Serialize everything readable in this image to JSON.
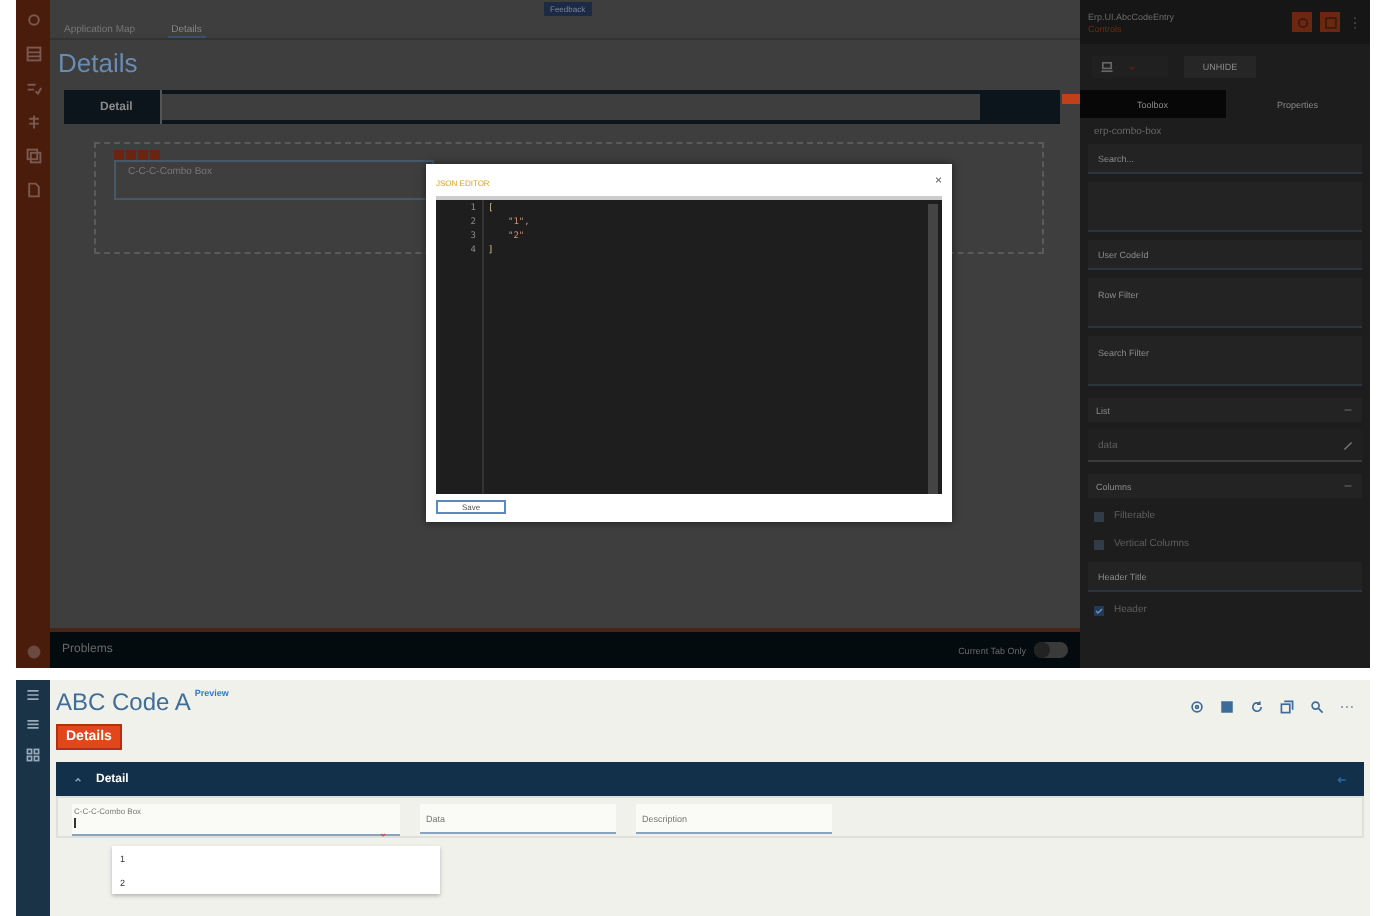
{
  "designer": {
    "feedback": "Feedback",
    "tabs": [
      {
        "label": "Application Map",
        "selected": false
      },
      {
        "label": "Details",
        "selected": true
      }
    ],
    "title": "Details",
    "panel_title": "Detail",
    "component_label": "C-C-C-Combo Box",
    "problems": "Problems",
    "toggle": {
      "label": "Current Tab Only",
      "on": false
    }
  },
  "side": {
    "title": "Erp.UI.AbcCodeEntry",
    "subtitle": "Controls",
    "unhide": "UNHIDE",
    "tabs": [
      {
        "label": "Toolbox",
        "selected": true
      },
      {
        "label": "Properties",
        "selected": false
      }
    ],
    "component": "erp-combo-box",
    "properties": [
      {
        "kind": "field",
        "placeholder": "Search..."
      },
      {
        "kind": "textarea"
      },
      {
        "kind": "field",
        "placeholder": "User CodeId"
      },
      {
        "kind": "textarea",
        "placeholder": "Row Filter"
      },
      {
        "kind": "textarea",
        "placeholder": "Search Filter"
      },
      {
        "kind": "section",
        "label": "List"
      },
      {
        "kind": "edit",
        "label": "data"
      },
      {
        "kind": "section",
        "label": "Columns"
      },
      {
        "kind": "checkbox",
        "label": "Filterable",
        "checked": false
      },
      {
        "kind": "checkbox",
        "label": "Vertical Columns",
        "checked": false
      },
      {
        "kind": "field",
        "placeholder": "Header Title"
      },
      {
        "kind": "checkbox",
        "label": "Header",
        "checked": true
      }
    ]
  },
  "json_editor": {
    "title": "JSON EDITOR",
    "close": "×",
    "lines": [
      {
        "number": "1",
        "text": "["
      },
      {
        "number": "2",
        "text": "\"1\","
      },
      {
        "number": "3",
        "text": "\"2\""
      },
      {
        "number": "4",
        "text": "]"
      }
    ],
    "save": "Save"
  },
  "preview": {
    "title": "ABC Code A",
    "badge": "Preview",
    "button": "Details",
    "panel_title": "Detail",
    "combo": {
      "label": "C-C-C-Combo Box",
      "options": [
        "1",
        "2"
      ]
    },
    "fields": [
      {
        "placeholder": "Data"
      },
      {
        "placeholder": "Description"
      }
    ]
  }
}
